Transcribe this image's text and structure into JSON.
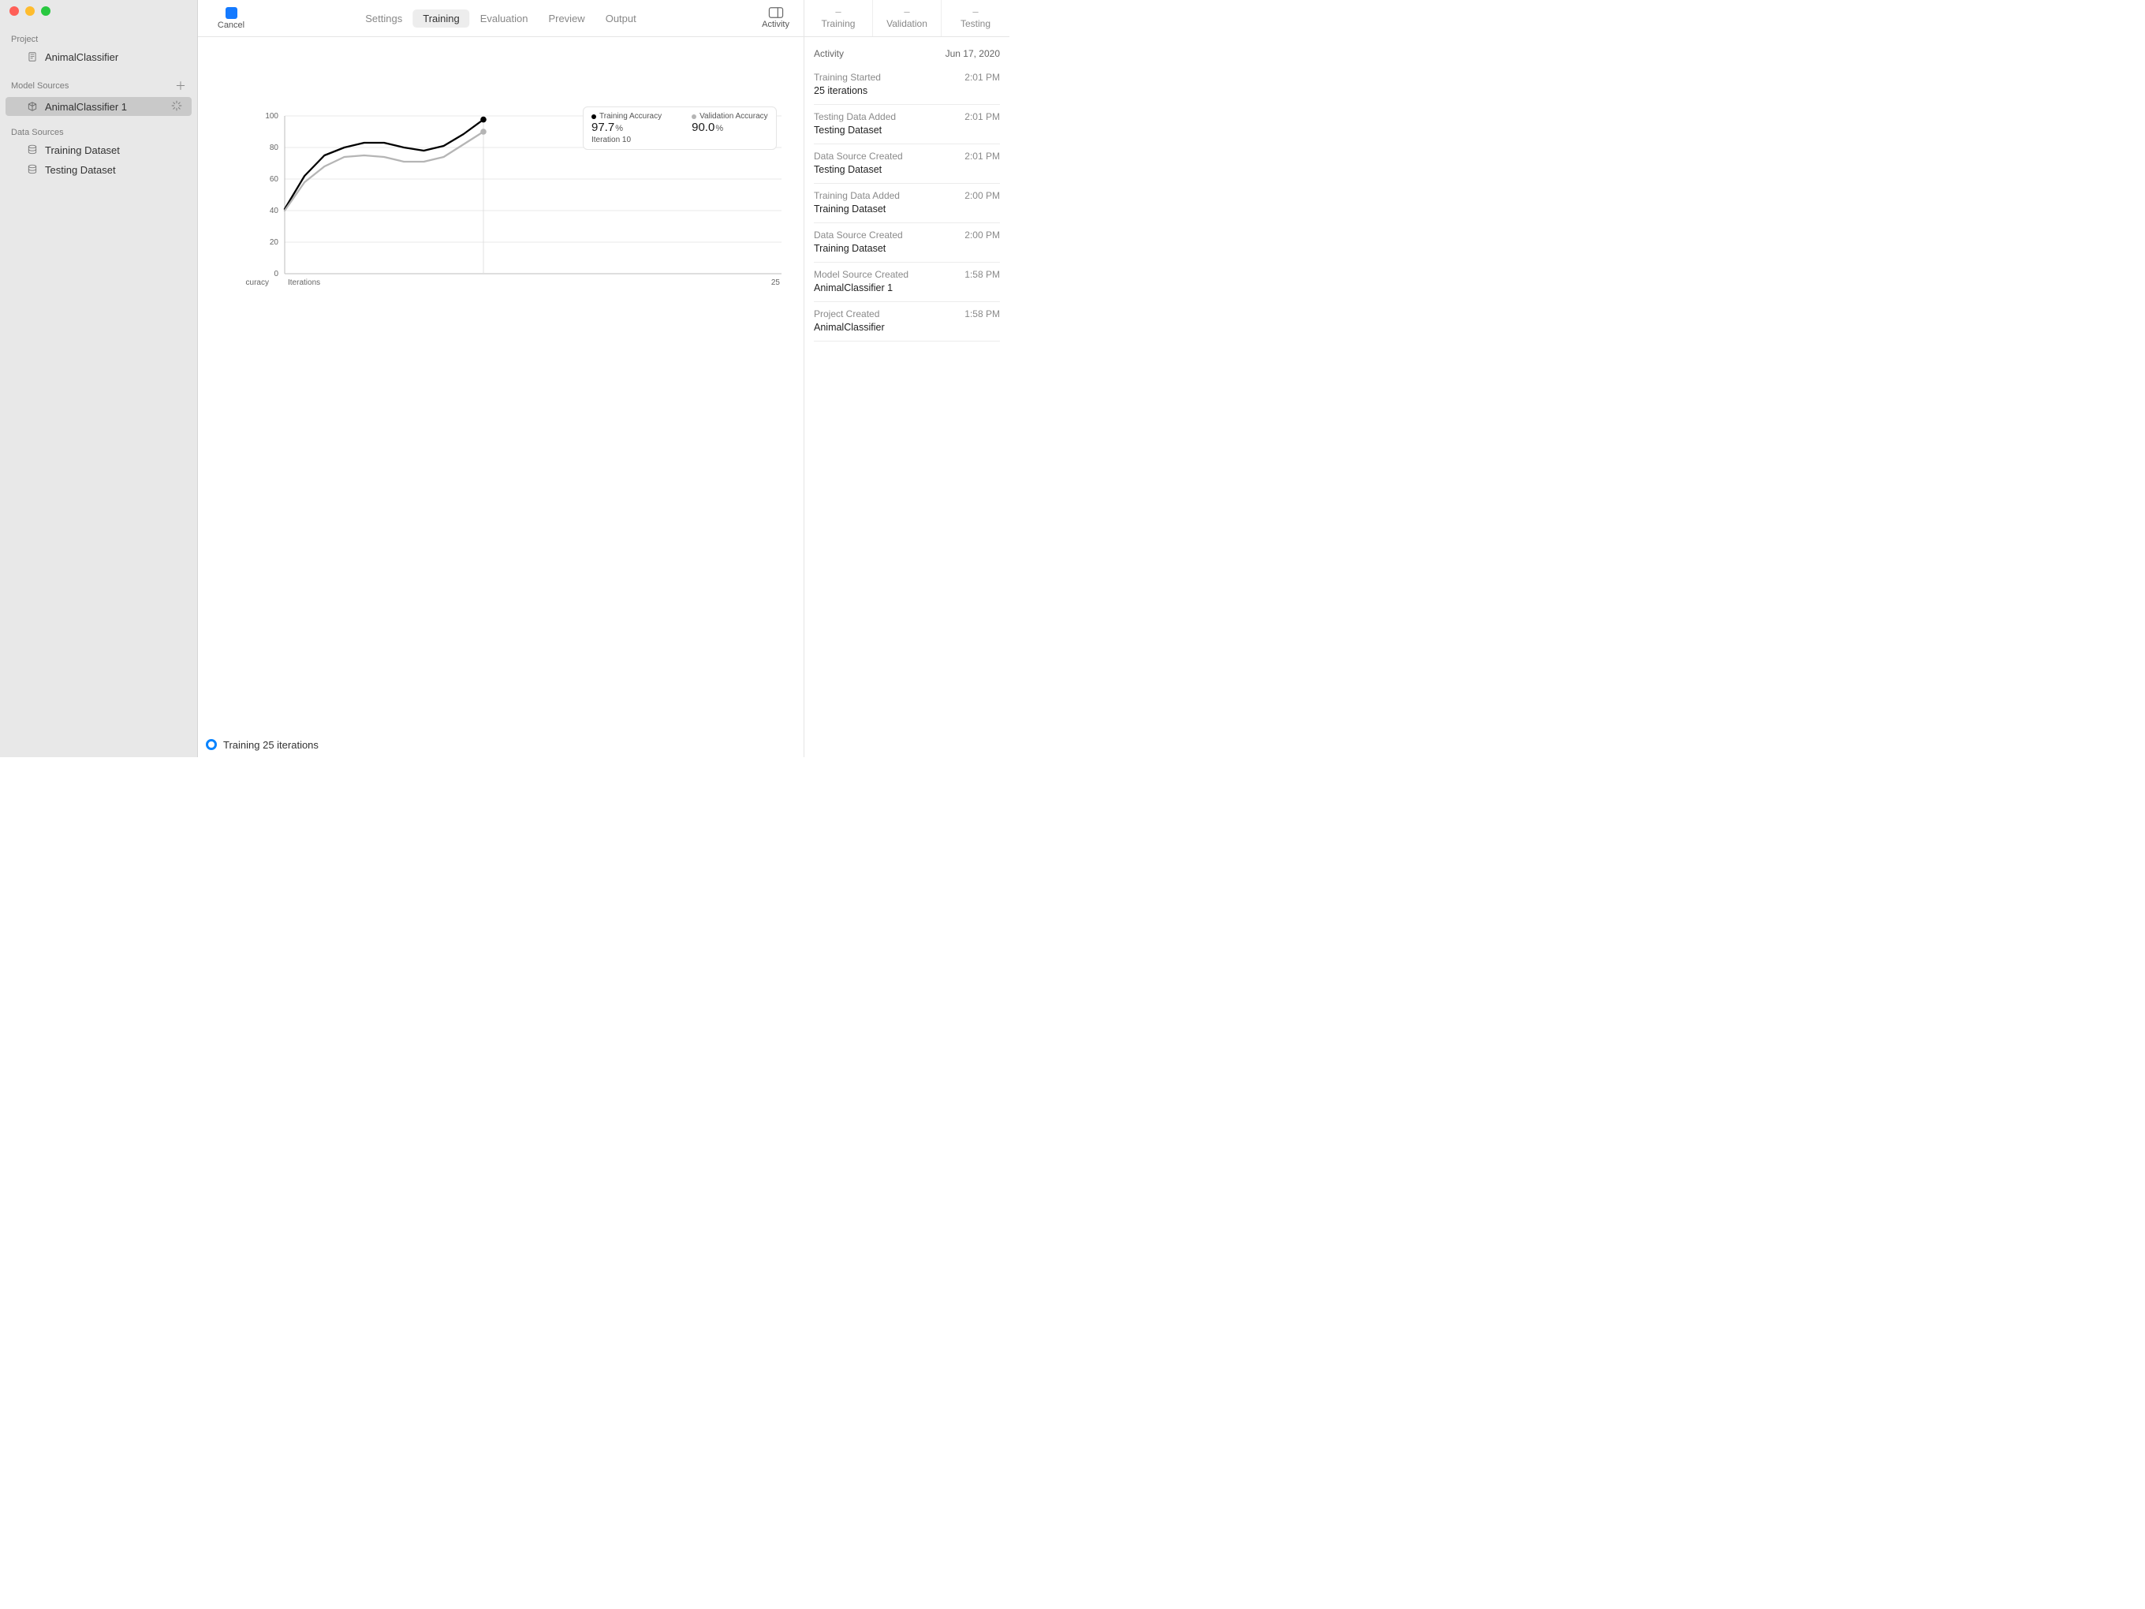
{
  "toolbar": {
    "cancel_label": "Cancel",
    "activity_label": "Activity",
    "tabs": [
      "Settings",
      "Training",
      "Evaluation",
      "Preview",
      "Output"
    ],
    "active_tab_index": 1
  },
  "sidebar": {
    "project_header": "Project",
    "project_name": "AnimalClassifier",
    "model_sources_header": "Model Sources",
    "model_source_name": "AnimalClassifier 1",
    "data_sources_header": "Data Sources",
    "data_sources": [
      "Training Dataset",
      "Testing Dataset"
    ]
  },
  "chart_data": {
    "type": "line",
    "title": "",
    "xlabel": "Iterations",
    "ylabel": "Accuracy",
    "xlim": [
      0,
      25
    ],
    "ylim": [
      0,
      100
    ],
    "yticks": [
      0,
      20,
      40,
      60,
      80,
      100
    ],
    "current_iteration": 10,
    "legend": {
      "training": {
        "label": "Training Accuracy",
        "value": "97.7",
        "unit": "%"
      },
      "validation": {
        "label": "Validation Accuracy",
        "value": "90.0",
        "unit": "%"
      },
      "iteration_label": "Iteration 10"
    },
    "series": [
      {
        "name": "Training Accuracy",
        "color": "#000000",
        "x": [
          0,
          1,
          2,
          3,
          4,
          5,
          6,
          7,
          8,
          9,
          10
        ],
        "values": [
          41,
          62,
          75,
          80,
          83,
          83,
          80,
          78,
          81,
          88.5,
          97.7
        ]
      },
      {
        "name": "Validation Accuracy",
        "color": "#b5b5b5",
        "x": [
          0,
          1,
          2,
          3,
          4,
          5,
          6,
          7,
          8,
          9,
          10
        ],
        "values": [
          40,
          58,
          68,
          74,
          75,
          74,
          71,
          71,
          74,
          82,
          90
        ]
      }
    ]
  },
  "status_bar": "Training 25 iterations",
  "right_panel": {
    "metrics": [
      {
        "dash": "–",
        "label": "Training"
      },
      {
        "dash": "–",
        "label": "Validation"
      },
      {
        "dash": "–",
        "label": "Testing"
      }
    ],
    "activity_header": "Activity",
    "activity_date": "Jun 17, 2020",
    "items": [
      {
        "title": "Training Started",
        "time": "2:01 PM",
        "detail": "25 iterations"
      },
      {
        "title": "Testing Data Added",
        "time": "2:01 PM",
        "detail": "Testing Dataset"
      },
      {
        "title": "Data Source Created",
        "time": "2:01 PM",
        "detail": "Testing Dataset"
      },
      {
        "title": "Training Data Added",
        "time": "2:00 PM",
        "detail": "Training Dataset"
      },
      {
        "title": "Data Source Created",
        "time": "2:00 PM",
        "detail": "Training Dataset"
      },
      {
        "title": "Model Source Created",
        "time": "1:58 PM",
        "detail": "AnimalClassifier 1"
      },
      {
        "title": "Project Created",
        "time": "1:58 PM",
        "detail": "AnimalClassifier"
      }
    ]
  }
}
